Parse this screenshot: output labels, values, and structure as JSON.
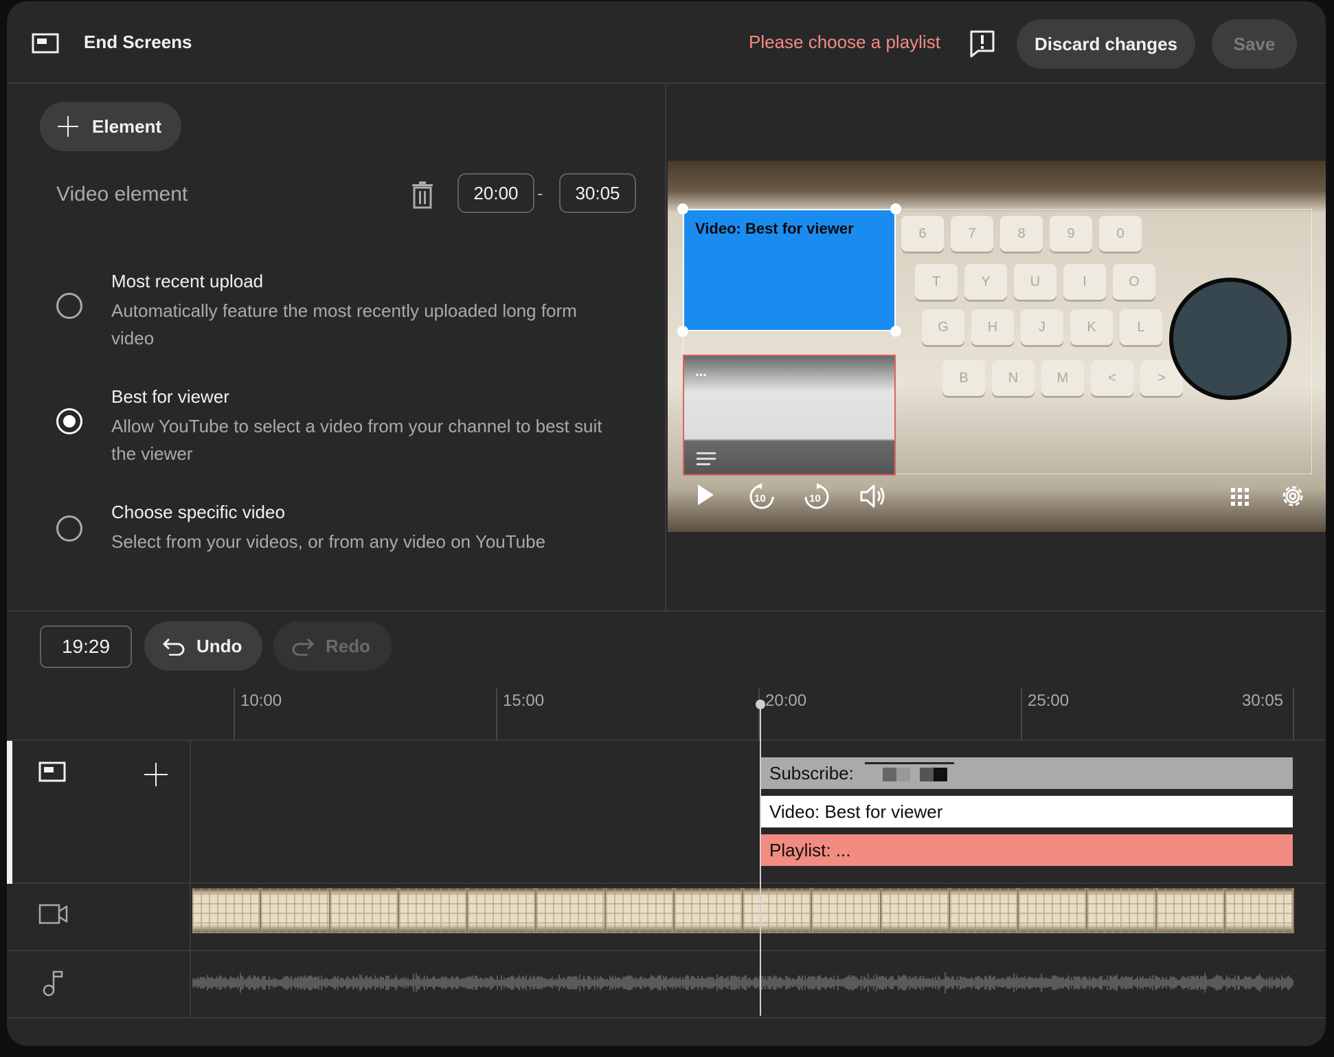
{
  "header": {
    "title": "End Screens",
    "warning": "Please choose a playlist",
    "discard_label": "Discard changes",
    "save_label": "Save"
  },
  "editor": {
    "add_element_label": "Element",
    "element_title": "Video element",
    "start_time": "20:00",
    "end_time": "30:05",
    "dash": "-",
    "options": [
      {
        "title": "Most recent upload",
        "desc": "Automatically feature the most recently uploaded long form video",
        "selected": false
      },
      {
        "title": "Best for viewer",
        "desc": "Allow YouTube to select a video from your channel to best suit the viewer",
        "selected": true
      },
      {
        "title": "Choose specific video",
        "desc": "Select from your videos, or from any video on YouTube",
        "selected": false
      }
    ]
  },
  "preview": {
    "video_card_label": "Video: Best for viewer",
    "playlist_card_label": "...",
    "keyboard_keys_row1": [
      "6",
      "7",
      "8",
      "9",
      "0"
    ],
    "keyboard_keys_row2": [
      "T",
      "Y",
      "U",
      "I",
      "O"
    ],
    "keyboard_keys_row3": [
      "G",
      "H",
      "J",
      "K",
      "L"
    ],
    "keyboard_keys_row4": [
      "B",
      "N",
      "M",
      "<",
      ">"
    ]
  },
  "timeline_toolbar": {
    "current_time": "19:29",
    "undo_label": "Undo",
    "redo_label": "Redo"
  },
  "ruler": {
    "labels": [
      "10:00",
      "15:00",
      "20:00",
      "25:00",
      "30:05"
    ]
  },
  "tracks": {
    "end_screen_bars": [
      {
        "label": "Subscribe:",
        "color": "#aaaaaa"
      },
      {
        "label": "Video: Best for viewer",
        "color": "#ffffff"
      },
      {
        "label": "Playlist: ...",
        "color": "#f28b82"
      }
    ]
  },
  "colors": {
    "accent_warning": "#f28b82",
    "video_card": "#1a8cf0",
    "background": "#282828"
  }
}
